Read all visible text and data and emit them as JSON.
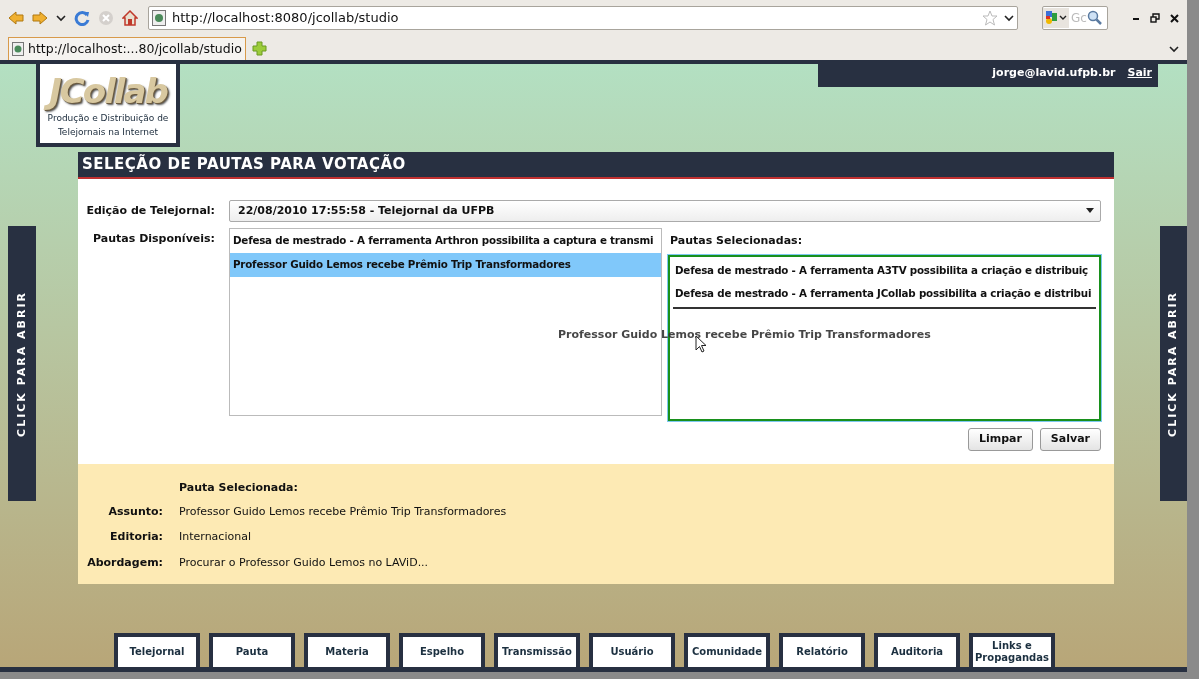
{
  "browser": {
    "address": "http://localhost:8080/jcollab/studio",
    "tab_title": "http://localhost:...80/jcollab/studio",
    "search_placeholder": "Gc"
  },
  "logo": {
    "name": "JCollab",
    "tagline": "Produção e Distribuição de Telejornais na Internet"
  },
  "user": {
    "email": "jorge@lavid.ufpb.br",
    "logout": "Sair"
  },
  "side_tabs": [
    "CLICK PARA ABRIR",
    "CLICK PARA ABRIR"
  ],
  "panel": {
    "title": "SELEÇÃO DE PAUTAS PARA VOTAÇÃO",
    "edition": {
      "label": "Edição de Telejornal:",
      "value": "22/08/2010 17:55:58 - Telejornal da UFPB"
    },
    "available": {
      "label": "Pautas Disponíveis:",
      "items": [
        {
          "text": "Defesa de mestrado - A ferramenta Arthron possibilita a captura e transmi",
          "selected": false
        },
        {
          "text": "Professor Guido Lemos recebe Prêmio Trip Transformadores",
          "selected": true
        }
      ]
    },
    "chosen": {
      "label": "Pautas Selecionadas:",
      "items": [
        {
          "text": "Defesa de mestrado - A ferramenta A3TV possibilita a criação e distribuiç"
        },
        {
          "text": "Defesa de mestrado - A ferramenta JCollab possibilita a criação e distribui"
        }
      ]
    },
    "dragged_item": "Professor Guido Lemos recebe Prêmio Trip Transformadores",
    "buttons": [
      "Limpar",
      "Salvar"
    ]
  },
  "details": {
    "title": "Pauta Selecionada:",
    "fields": [
      {
        "label": "Assunto:",
        "value": "Professor Guido Lemos recebe Prêmio Trip Transformadores"
      },
      {
        "label": "Editoria:",
        "value": "Internacional"
      },
      {
        "label": "Abordagem:",
        "value": "Procurar o Professor Guido Lemos no LAViD..."
      }
    ]
  },
  "nav": [
    "Telejornal",
    "Pauta",
    "Materia",
    "Espelho",
    "Transmissão",
    "Usuário",
    "Comunidade",
    "Relatório",
    "Auditoria",
    "Links e Propagandas"
  ]
}
